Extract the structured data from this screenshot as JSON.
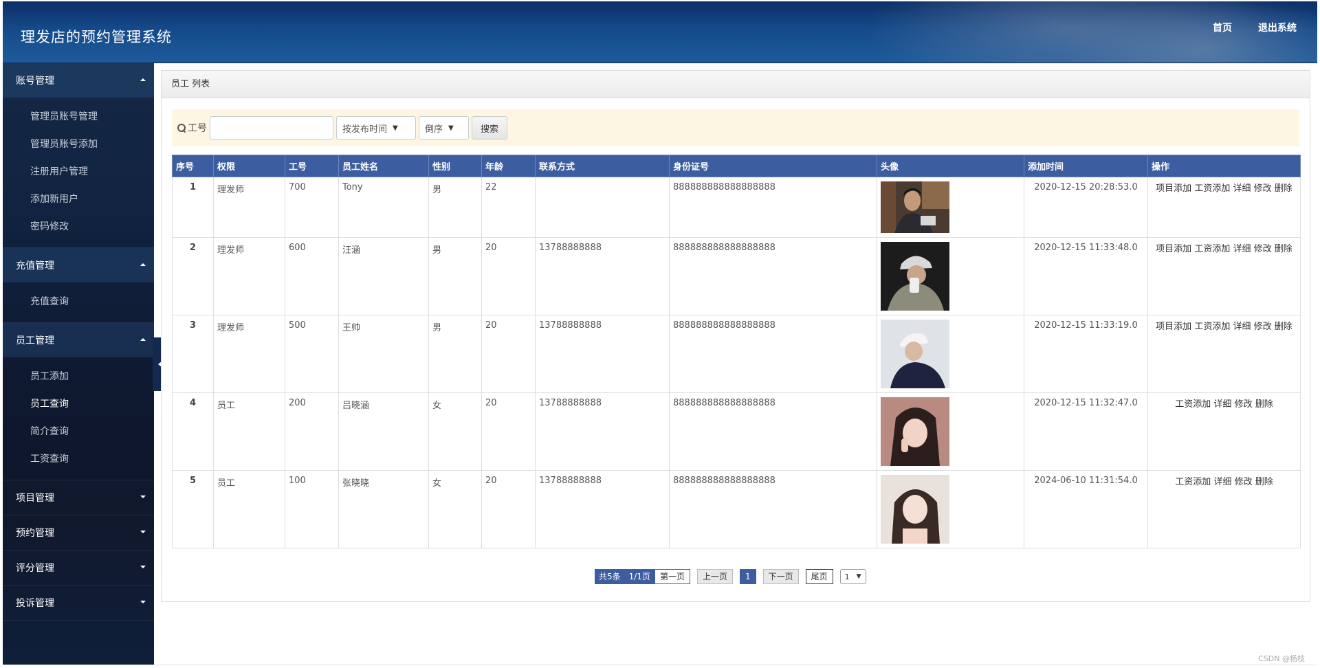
{
  "header": {
    "title": "理发店的预约管理系统",
    "nav": [
      {
        "label": "首页"
      },
      {
        "label": "退出系统"
      }
    ]
  },
  "sidebar": {
    "groups": [
      {
        "label": "账号管理",
        "expanded": true,
        "items": [
          {
            "label": "管理员账号管理"
          },
          {
            "label": "管理员账号添加"
          },
          {
            "label": "注册用户管理"
          },
          {
            "label": "添加新用户"
          },
          {
            "label": "密码修改"
          }
        ]
      },
      {
        "label": "充值管理",
        "expanded": true,
        "items": [
          {
            "label": "充值查询"
          }
        ]
      },
      {
        "label": "员工管理",
        "expanded": true,
        "items": [
          {
            "label": "员工添加"
          },
          {
            "label": "员工查询"
          },
          {
            "label": "简介查询"
          },
          {
            "label": "工资查询"
          }
        ]
      },
      {
        "label": "项目管理",
        "expanded": false
      },
      {
        "label": "预约管理",
        "expanded": false
      },
      {
        "label": "评分管理",
        "expanded": false
      },
      {
        "label": "投诉管理",
        "expanded": false
      }
    ]
  },
  "panel": {
    "title": "员工 列表",
    "search": {
      "label": "工号",
      "value": "",
      "sort_field": "按发布时间",
      "sort_order": "倒序",
      "button": "搜索"
    },
    "columns": [
      "序号",
      "权限",
      "工号",
      "员工姓名",
      "性别",
      "年龄",
      "联系方式",
      "身份证号",
      "头像",
      "添加时间",
      "操作"
    ],
    "rows": [
      {
        "idx": "1",
        "role": "理发师",
        "id": "700",
        "name": "Tony",
        "gender": "男",
        "age": "22",
        "phone": "",
        "idcard": "888888888888888888",
        "time": "2020-12-15 20:28:53.0",
        "ops": [
          "项目添加",
          "工资添加",
          "详细",
          "修改",
          "删除"
        ]
      },
      {
        "idx": "2",
        "role": "理发师",
        "id": "600",
        "name": "汪涵",
        "gender": "男",
        "age": "20",
        "phone": "13788888888",
        "idcard": "888888888888888888",
        "time": "2020-12-15 11:33:48.0",
        "ops": [
          "项目添加",
          "工资添加",
          "详细",
          "修改",
          "删除"
        ]
      },
      {
        "idx": "3",
        "role": "理发师",
        "id": "500",
        "name": "王帅",
        "gender": "男",
        "age": "20",
        "phone": "13788888888",
        "idcard": "888888888888888888",
        "time": "2020-12-15 11:33:19.0",
        "ops": [
          "项目添加",
          "工资添加",
          "详细",
          "修改",
          "删除"
        ]
      },
      {
        "idx": "4",
        "role": "员工",
        "id": "200",
        "name": "吕晓涵",
        "gender": "女",
        "age": "20",
        "phone": "13788888888",
        "idcard": "888888888888888888",
        "time": "2020-12-15 11:32:47.0",
        "ops": [
          "工资添加",
          "详细",
          "修改",
          "删除"
        ]
      },
      {
        "idx": "5",
        "role": "员工",
        "id": "100",
        "name": "张晓晓",
        "gender": "女",
        "age": "20",
        "phone": "13788888888",
        "idcard": "888888888888888888",
        "time": "2024-06-10 11:31:54.0",
        "ops": [
          "工资添加",
          "详细",
          "修改",
          "删除"
        ]
      }
    ]
  },
  "pager": {
    "total": "共5条",
    "pages": "1/1页",
    "first": "第一页",
    "prev": "上一页",
    "current": "1",
    "next": "下一页",
    "last": "尾页",
    "jump": "1"
  },
  "watermark": "CSDN @杨枝",
  "colors": {
    "header_blue": "#154a8a",
    "table_header": "#3c5d9f",
    "search_bg": "#fdf6e3"
  }
}
